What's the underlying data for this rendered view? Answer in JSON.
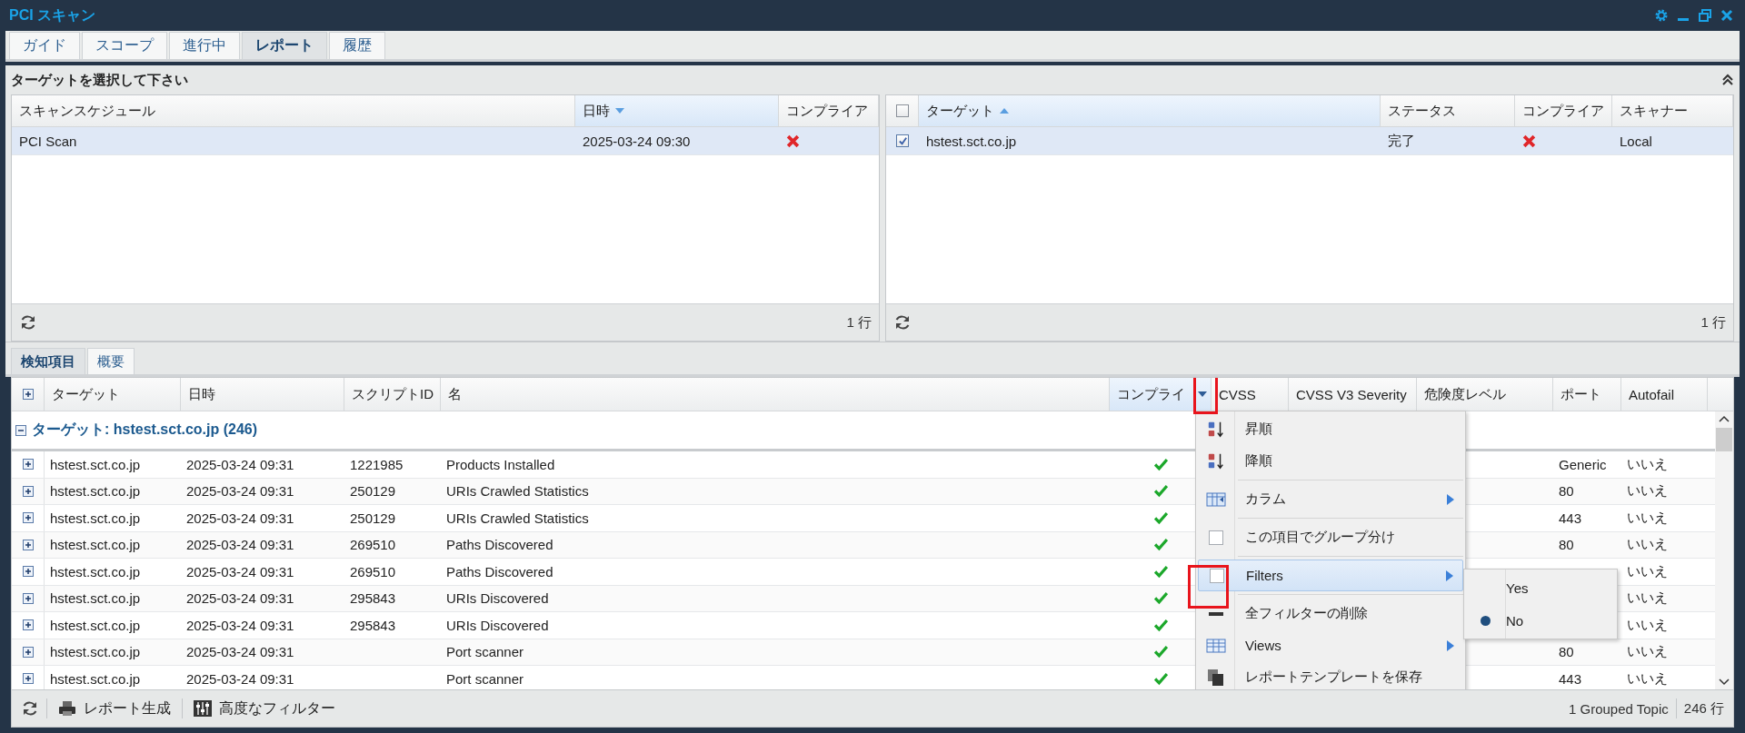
{
  "window": {
    "title": "PCI スキャン"
  },
  "tabs": [
    {
      "label": "ガイド",
      "selected": false
    },
    {
      "label": "スコープ",
      "selected": false
    },
    {
      "label": "進行中",
      "selected": false
    },
    {
      "label": "レポート",
      "selected": true
    },
    {
      "label": "履歴",
      "selected": false
    }
  ],
  "target_panel": {
    "title": "ターゲットを選択して下さい",
    "schedules": {
      "columns": [
        {
          "label": "スキャンスケジュール",
          "sorted": false
        },
        {
          "label": "日時",
          "sorted": true,
          "descending": true
        },
        {
          "label": "コンプライア",
          "sorted": false
        }
      ],
      "rows": [
        {
          "name": "PCI Scan",
          "datetime": "2025-03-24 09:30",
          "compliant": false,
          "selected": true
        }
      ],
      "count": "1 行"
    },
    "targets": {
      "all_checked": false,
      "columns": [
        {
          "label": "ターゲット",
          "sorted": true,
          "descending": false
        },
        {
          "label": "ステータス",
          "sorted": false
        },
        {
          "label": "コンプライア",
          "sorted": false
        },
        {
          "label": "スキャナー",
          "sorted": false
        }
      ],
      "rows": [
        {
          "target": "hstest.sct.co.jp",
          "status": "完了",
          "compliant": false,
          "scanner": "Local",
          "checked": true,
          "selected": true
        }
      ],
      "count": "1 行"
    }
  },
  "detail_tabs": [
    {
      "label": "検知項目",
      "selected": true
    },
    {
      "label": "概要",
      "selected": false
    }
  ],
  "grid": {
    "columns": [
      {
        "label": "ターゲット",
        "active": false
      },
      {
        "label": "日時",
        "active": false
      },
      {
        "label": "スクリプトID",
        "active": false
      },
      {
        "label": "名",
        "active": false
      },
      {
        "label": "コンプライ",
        "active": true
      },
      {
        "label": "CVSS",
        "active": false
      },
      {
        "label": "CVSS V3 Severity",
        "active": false
      },
      {
        "label": "危険度レベル",
        "active": false
      },
      {
        "label": "ポート",
        "active": false
      },
      {
        "label": "Autofail",
        "active": false
      }
    ],
    "group": {
      "label": "ターゲット: hstest.sct.co.jp (246)",
      "expanded": true
    },
    "rows": [
      {
        "target": "hstest.sct.co.jp",
        "datetime": "2025-03-24 09:31",
        "script_id": "1221985",
        "name": "Products Installed",
        "compliant": true,
        "port": "Generic",
        "autofail": "いいえ"
      },
      {
        "target": "hstest.sct.co.jp",
        "datetime": "2025-03-24 09:31",
        "script_id": "250129",
        "name": "URIs Crawled Statistics",
        "compliant": true,
        "port": "80",
        "autofail": "いいえ"
      },
      {
        "target": "hstest.sct.co.jp",
        "datetime": "2025-03-24 09:31",
        "script_id": "250129",
        "name": "URIs Crawled Statistics",
        "compliant": true,
        "port": "443",
        "autofail": "いいえ"
      },
      {
        "target": "hstest.sct.co.jp",
        "datetime": "2025-03-24 09:31",
        "script_id": "269510",
        "name": "Paths Discovered",
        "compliant": true,
        "port": "80",
        "autofail": "いいえ"
      },
      {
        "target": "hstest.sct.co.jp",
        "datetime": "2025-03-24 09:31",
        "script_id": "269510",
        "name": "Paths Discovered",
        "compliant": true,
        "autofail": "いいえ"
      },
      {
        "target": "hstest.sct.co.jp",
        "datetime": "2025-03-24 09:31",
        "script_id": "295843",
        "name": "URIs Discovered",
        "compliant": true,
        "autofail": "いいえ"
      },
      {
        "target": "hstest.sct.co.jp",
        "datetime": "2025-03-24 09:31",
        "script_id": "295843",
        "name": "URIs Discovered",
        "compliant": true,
        "autofail": "いいえ"
      },
      {
        "target": "hstest.sct.co.jp",
        "datetime": "2025-03-24 09:31",
        "name": "Port scanner",
        "compliant": true,
        "port": "80",
        "autofail": "いいえ"
      },
      {
        "target": "hstest.sct.co.jp",
        "datetime": "2025-03-24 09:31",
        "name": "Port scanner",
        "compliant": true,
        "port": "443",
        "autofail": "いいえ"
      }
    ]
  },
  "column_menu": {
    "items": [
      {
        "kind": "sort-asc",
        "label": "昇順"
      },
      {
        "kind": "sort-desc",
        "label": "降順"
      },
      {
        "kind": "columns",
        "label": "カラム",
        "submenu": true
      },
      {
        "kind": "group",
        "label": "この項目でグループ分け",
        "checked": false
      },
      {
        "kind": "filters",
        "label": "Filters",
        "checked": false,
        "submenu": true,
        "highlighted": true
      },
      {
        "kind": "clear",
        "label": "全フィルターの削除"
      },
      {
        "kind": "views",
        "label": "Views",
        "submenu": true
      },
      {
        "kind": "save",
        "label": "レポートテンプレートを保存"
      }
    ],
    "filter_submenu": [
      {
        "label": "Yes",
        "selected": false
      },
      {
        "label": "No",
        "selected": true
      }
    ]
  },
  "toolbar": {
    "buttons": [
      {
        "kind": "report",
        "label": "レポート生成"
      },
      {
        "kind": "filter",
        "label": "高度なフィルター"
      }
    ],
    "group_info": "1 Grouped Topic",
    "count": "246 行"
  }
}
